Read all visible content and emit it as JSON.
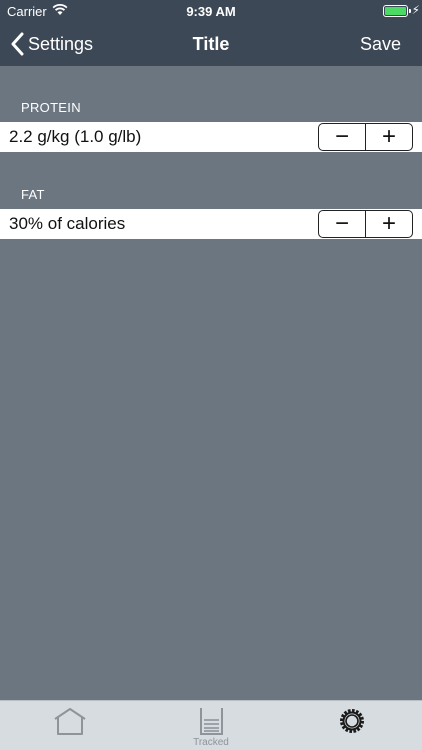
{
  "status_bar": {
    "carrier": "Carrier",
    "time": "9:39 AM",
    "battery_color": "#4cd964"
  },
  "nav": {
    "back_label": "Settings",
    "title": "Title",
    "save_label": "Save",
    "bar_color": "#3c4855"
  },
  "sections": [
    {
      "header": "PROTEIN",
      "value": "2.2 g/kg (1.0 g/lb)",
      "decrement": "−",
      "increment": "+"
    },
    {
      "header": "FAT",
      "value": "30% of calories",
      "decrement": "−",
      "increment": "+"
    }
  ],
  "tabbar": {
    "tabs": [
      {
        "icon": "home-icon",
        "label": ""
      },
      {
        "icon": "tracked-icon",
        "label": "Tracked"
      },
      {
        "icon": "gear-icon",
        "label": ""
      }
    ]
  },
  "background_color": "#6b7681"
}
